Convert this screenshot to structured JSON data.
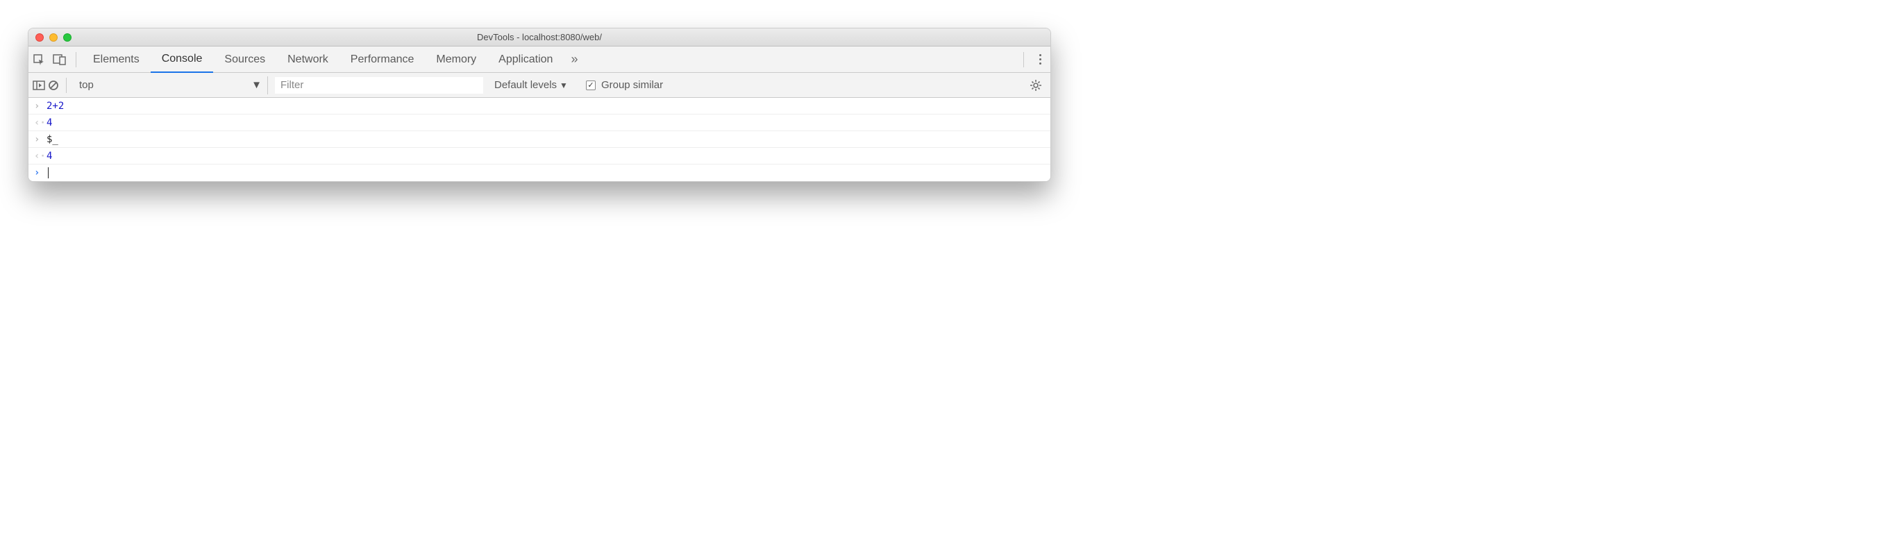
{
  "window": {
    "title": "DevTools - localhost:8080/web/"
  },
  "tabs": {
    "items": [
      "Elements",
      "Console",
      "Sources",
      "Network",
      "Performance",
      "Memory",
      "Application"
    ],
    "active": "Console"
  },
  "toolbar": {
    "context": "top",
    "filter_placeholder": "Filter",
    "levels_label": "Default levels",
    "group_label": "Group similar",
    "group_checked": true
  },
  "console": {
    "lines": [
      {
        "kind": "input",
        "text": "2+2"
      },
      {
        "kind": "output",
        "text": "4"
      },
      {
        "kind": "input",
        "text": "$_"
      },
      {
        "kind": "output",
        "text": "4"
      },
      {
        "kind": "prompt",
        "text": ""
      }
    ]
  }
}
